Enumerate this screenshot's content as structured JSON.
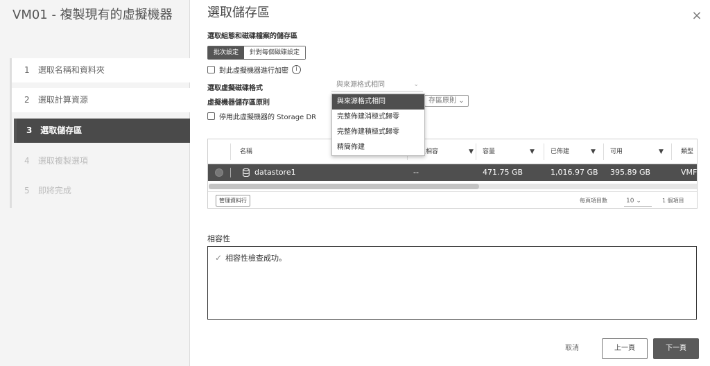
{
  "wizard": {
    "title": "VM01 - 複製現有的虛擬機器",
    "steps": [
      {
        "num": "1",
        "label": "選取名稱和資料夾"
      },
      {
        "num": "2",
        "label": "選取計算資源"
      },
      {
        "num": "3",
        "label": "選取儲存區"
      },
      {
        "num": "4",
        "label": "選取複製選項"
      },
      {
        "num": "5",
        "label": "即將完成"
      }
    ],
    "active_step": 3
  },
  "main": {
    "title": "選取儲存區",
    "subtitle": "選取組態和磁碟檔案的儲存區",
    "tabs": [
      "批次設定",
      "針對每個磁碟設定"
    ],
    "active_tab": "批次設定",
    "encrypt_label": "對此虛擬機器進行加密",
    "info_icon": "i",
    "disk_format_label": "選取虛擬磁碟格式",
    "disk_format_value": "與來源格式相同",
    "policy_label": "虛擬機器儲存區原則",
    "policy_value": "存區原則",
    "sdrs_label": "停用此虛擬機器的 Storage DR",
    "close_icon": "×"
  },
  "dropdown": {
    "options": [
      "與來源格式相同",
      "完整佈建消極式歸零",
      "完整佈建積極式歸零",
      "精簡佈建"
    ],
    "selected_index": 0
  },
  "table": {
    "columns": [
      "名稱",
      "存區相容",
      "容量",
      "已佈建",
      "可用",
      "類型"
    ],
    "rows": [
      {
        "name": "datastore1",
        "compat": "--",
        "capacity": "471.75 GB",
        "provisioned": "1,016.97 GB",
        "free": "395.89 GB",
        "type": "VMF"
      }
    ],
    "manage_columns": "管理資料行",
    "per_page_label": "每頁項目數",
    "per_page_value": "10",
    "item_count": "1 個項目"
  },
  "compatibility": {
    "title": "相容性",
    "message": "相容性檢查成功。"
  },
  "buttons": {
    "cancel": "取消",
    "back": "上一頁",
    "next": "下一頁"
  }
}
